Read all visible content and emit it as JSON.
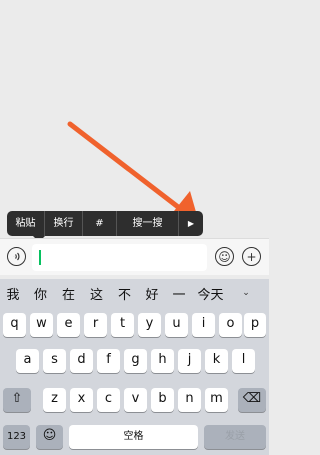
{
  "context_menu": {
    "items": [
      "粘贴",
      "换行",
      "#",
      "搜一搜",
      "▶"
    ]
  },
  "input_bar": {
    "voice_icon": "voice-icon",
    "emoji_icon": "emoji-icon",
    "plus_icon": "plus-icon",
    "value": ""
  },
  "candidates": {
    "items": [
      "我",
      "你",
      "在",
      "这",
      "不",
      "好",
      "一",
      "今天"
    ],
    "more_glyph": "⌄"
  },
  "keyboard": {
    "row1": [
      "q",
      "w",
      "e",
      "r",
      "t",
      "y",
      "u",
      "i",
      "o",
      "p"
    ],
    "row2": [
      "a",
      "s",
      "d",
      "f",
      "g",
      "h",
      "j",
      "k",
      "l"
    ],
    "row3": [
      "z",
      "x",
      "c",
      "v",
      "b",
      "n",
      "m"
    ],
    "shift_glyph": "⇧",
    "delete_glyph": "⌫",
    "numbers_label": "123",
    "emoji_glyph": "☺",
    "space_label": "空格",
    "send_label": "发送"
  },
  "colors": {
    "accent_arrow": "#f0622d",
    "caret": "#07c160"
  }
}
